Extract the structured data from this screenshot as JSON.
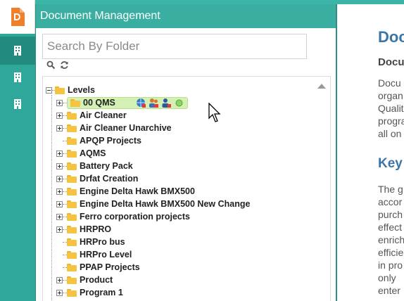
{
  "app": {
    "name": "Document Management"
  },
  "rail": {
    "items": [
      "building-icon",
      "building-icon",
      "building-icon"
    ]
  },
  "dialog": {
    "title": "Document Management",
    "search": {
      "placeholder": "Search By Folder",
      "value": ""
    },
    "tools": [
      "search-icon",
      "refresh-icon"
    ]
  },
  "tree": {
    "root": "Levels",
    "selected": "00 QMS",
    "items": [
      {
        "label": "00 QMS",
        "expandable": true
      },
      {
        "label": "Air Cleaner",
        "expandable": true
      },
      {
        "label": "Air Cleaner Unarchive",
        "expandable": true
      },
      {
        "label": "APQP Projects",
        "expandable": false
      },
      {
        "label": "AQMS",
        "expandable": true
      },
      {
        "label": "Battery Pack",
        "expandable": true
      },
      {
        "label": "Drfat Creation",
        "expandable": true
      },
      {
        "label": "Engine Delta Hawk BMX500",
        "expandable": true
      },
      {
        "label": "Engine Delta Hawk BMX500 New Change",
        "expandable": true
      },
      {
        "label": "Ferro corporation projects",
        "expandable": true
      },
      {
        "label": "HRPRO",
        "expandable": true
      },
      {
        "label": "HRPro bus",
        "expandable": false
      },
      {
        "label": "HRPro Level",
        "expandable": false
      },
      {
        "label": "PPAP Projects",
        "expandable": false
      },
      {
        "label": "Product",
        "expandable": true
      },
      {
        "label": "Program 1",
        "expandable": true
      }
    ]
  },
  "content": {
    "title": "Doc",
    "subtitle": "Docu",
    "para1": [
      "Docu",
      "organ",
      "Qualit",
      "progra",
      "all on"
    ],
    "key_heading": "Key",
    "para2": [
      "The g",
      "accor",
      "purch",
      "effect",
      "enrich",
      "efficie",
      "in pro",
      "only",
      "enter"
    ]
  }
}
